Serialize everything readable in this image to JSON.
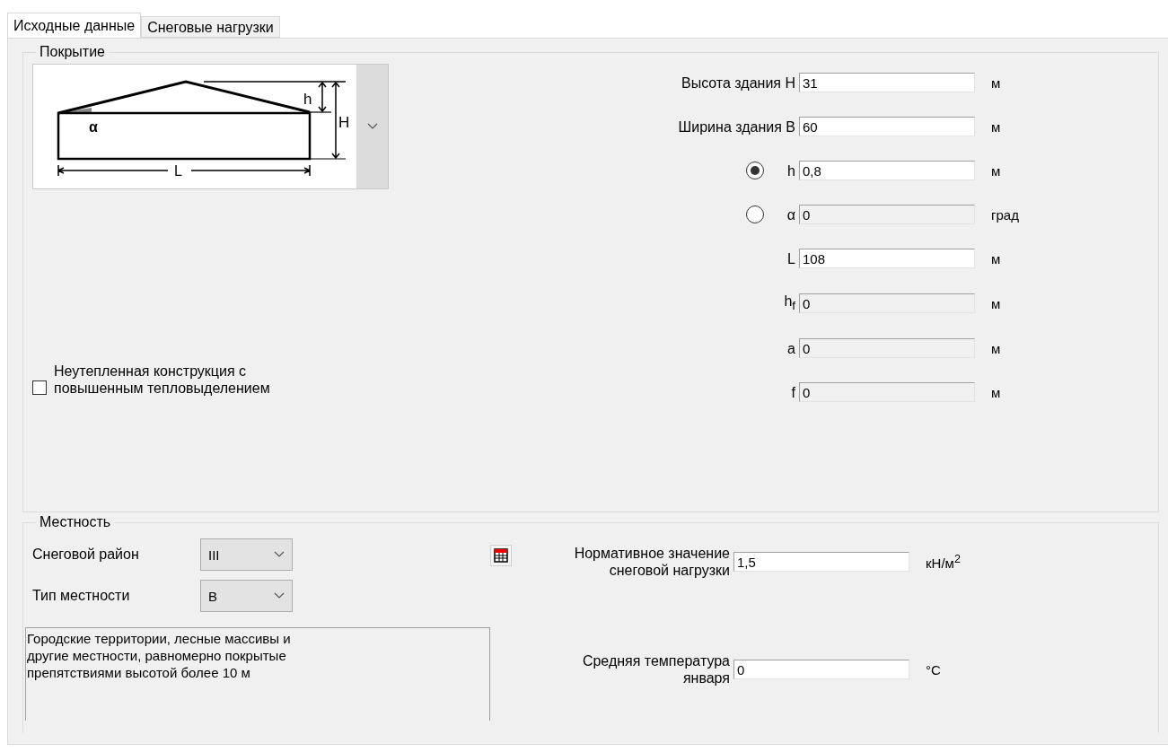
{
  "tabs": [
    {
      "label": "Исходные данные",
      "selected": true
    },
    {
      "label": "Снеговые нагрузки",
      "selected": false
    }
  ],
  "roof_group": {
    "title": "Покрытие",
    "diagram": {
      "labels": [
        "h",
        "α",
        "H",
        "L"
      ]
    },
    "fields": [
      {
        "kind": "text",
        "label": "Высота здания H",
        "value": "31",
        "unit": "м",
        "disabled": false
      },
      {
        "kind": "text",
        "label": "Ширина здания B",
        "value": "60",
        "unit": "м",
        "disabled": false
      },
      {
        "kind": "radio",
        "label": "h",
        "selected": true,
        "value": "0,8",
        "unit": "м",
        "disabled": false
      },
      {
        "kind": "radio",
        "label": "α",
        "selected": false,
        "value": "0",
        "unit": "град",
        "disabled": true
      },
      {
        "kind": "text",
        "label": "L",
        "value": "108",
        "unit": "м",
        "disabled": false
      },
      {
        "kind": "text",
        "label": "h$_{f}$",
        "value": "0",
        "unit": "м",
        "disabled": true
      },
      {
        "kind": "text",
        "label": "a",
        "value": "0",
        "unit": "м",
        "disabled": true
      },
      {
        "kind": "text",
        "label": "f",
        "value": "0",
        "unit": "м",
        "disabled": true
      }
    ],
    "checkbox": {
      "label": "Неутепленная конструкция с\nповышенным тепловыделением",
      "checked": false
    }
  },
  "terrain_group": {
    "title": "Местность",
    "selects": [
      {
        "label": "Снеговой район",
        "value": "III"
      },
      {
        "label": "Тип местности",
        "value": "В"
      }
    ],
    "description": "Городские территории, лесные массивы и\nдругие местности, равномерно покрытые\nпрепятствиями высотой более 10 м",
    "fields": [
      {
        "label": "Нормативное значение\nснеговой нагрузки",
        "value": "1,5",
        "unit": "кН/м$^{2}$"
      },
      {
        "label": "Средняя температура\nянваря",
        "value": "0",
        "unit": "°C"
      }
    ]
  }
}
